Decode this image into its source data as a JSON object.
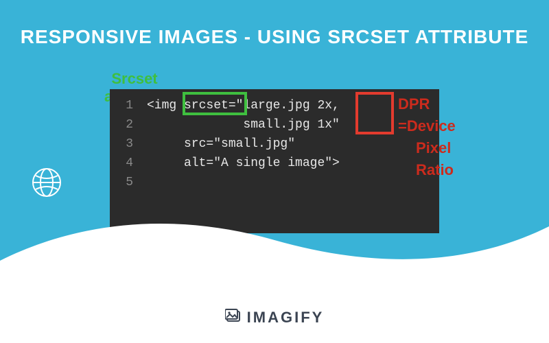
{
  "title": "RESPONSIVE IMAGES - USING SRCSET ATTRIBUTE",
  "annotations": {
    "srcset_label_l1": "Srcset",
    "srcset_label_l2": "attribute",
    "dpr_label_l1": "DPR",
    "dpr_label_l2": "=Device",
    "dpr_label_l3": "Pixel",
    "dpr_label_l4": "Ratio"
  },
  "code": {
    "line_numbers": [
      "1",
      "2",
      "3",
      "4",
      "5"
    ],
    "line1": "<img srcset=\"large.jpg 2x,",
    "line2": "             small.jpg 1x\"",
    "line3": "     src=\"small.jpg\"",
    "line4": "     alt=\"A single image\">",
    "line5": ""
  },
  "brand": "IMAGIFY",
  "colors": {
    "bg": "#39b3d7",
    "code_bg": "#2b2b2b",
    "green": "#3fbf3f",
    "red": "#e33b2e",
    "brand": "#3b4452"
  }
}
